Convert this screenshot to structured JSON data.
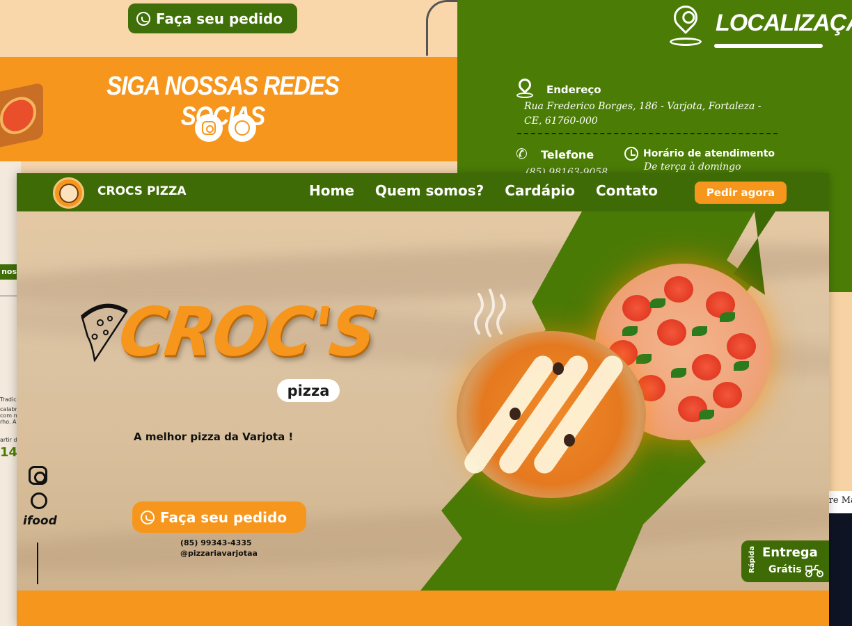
{
  "background": {
    "top_order_button": "Faça seu pedido",
    "social": {
      "title": "SIGA NOSSAS REDES SOCIAS",
      "icons": [
        "instagram-icon",
        "whatsapp-icon"
      ]
    },
    "left_fragments": {
      "tag": "nos",
      "lines": [
        "Tradic",
        "calabre",
        "com m",
        "rho. A M",
        "artir d"
      ],
      "price": "14"
    },
    "location": {
      "title": "LOCALIZAÇÃO",
      "address_label": "Endereço",
      "address": "Rua Frederico Borges, 186 - Varjota, Fortaleza - CE, 61760-000",
      "phone_label": "Telefone",
      "phone": "(85) 98163-9058",
      "hours_label": "Horário de atendimento",
      "hours": "De terça à domingo"
    },
    "right_fragment": "ere Ma"
  },
  "nav": {
    "brand": "CROCS PIZZA",
    "links": [
      "Home",
      "Quem somos?",
      "Cardápio",
      "Contato"
    ],
    "cta": "Pedir agora"
  },
  "hero": {
    "title": "CROC'S",
    "subtitle_tag": "pizza",
    "tagline": "A melhor pizza da Varjota !",
    "order_button": "Faça seu pedido",
    "phone": "(85) 99343-4335",
    "handle": "@pizzariavarjotaa",
    "side_icons": [
      "instagram-icon",
      "whatsapp-icon",
      "ifood-logo"
    ],
    "ifood_text": "ifood",
    "delivery": {
      "rapida": "Rápida",
      "entrega": "Entrega",
      "gratis": "Grátis"
    }
  },
  "colors": {
    "orange": "#f7961c",
    "green": "#3f6b06",
    "green_light": "#4b7d06",
    "sand": "#dcc4a4"
  }
}
